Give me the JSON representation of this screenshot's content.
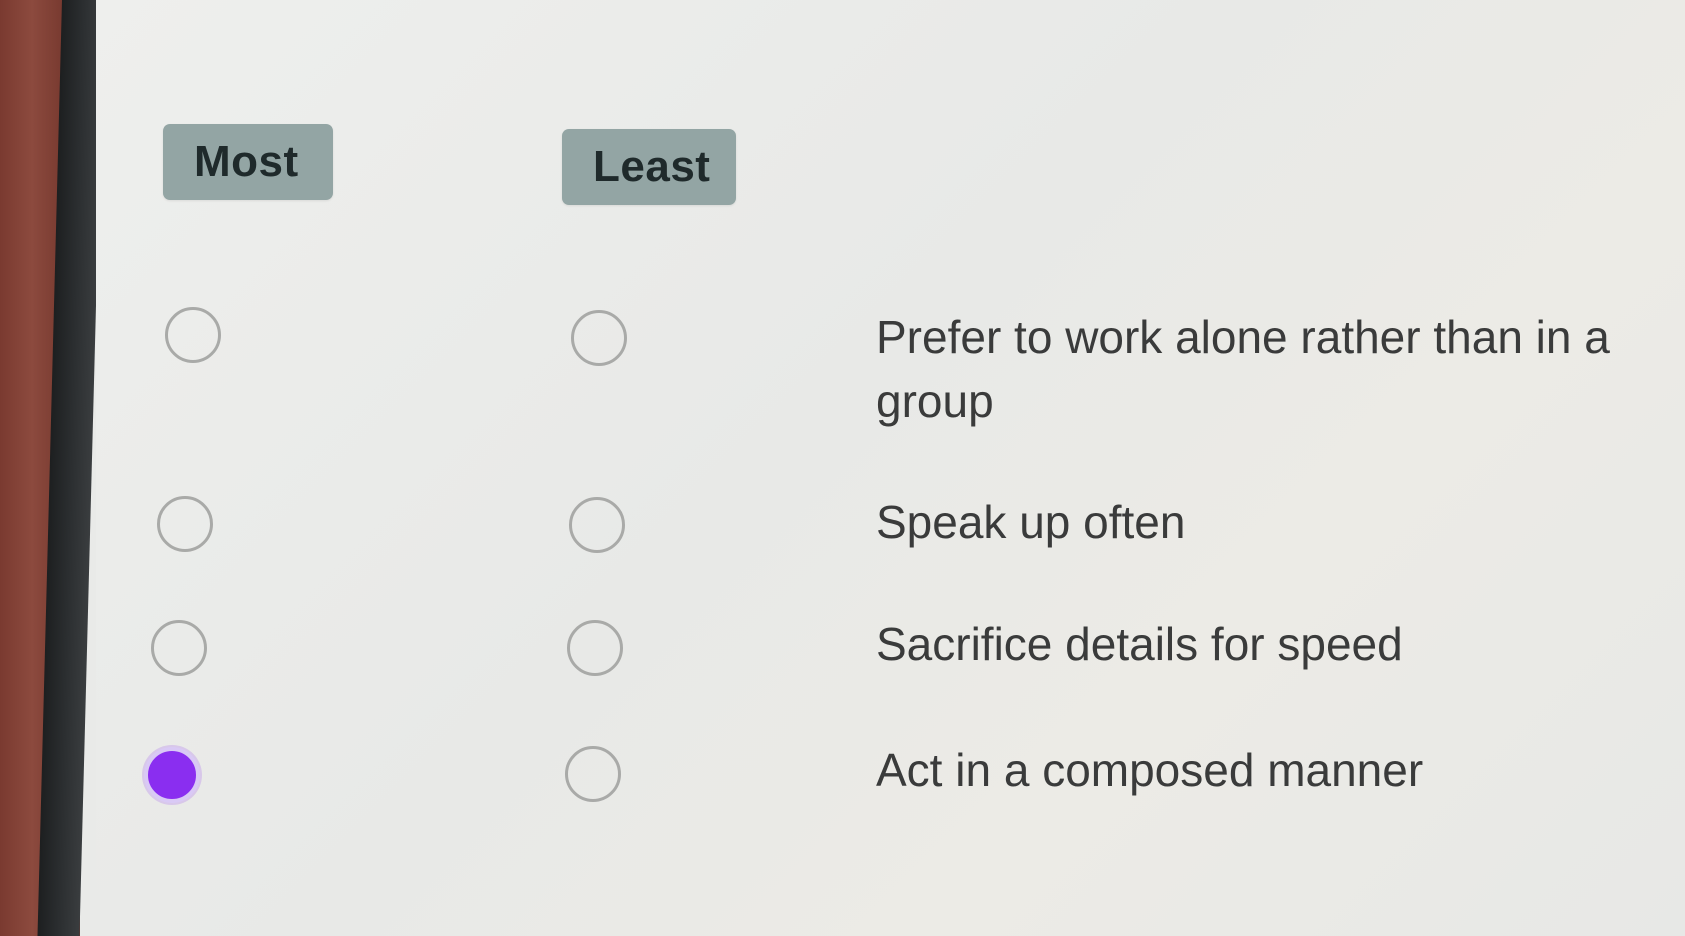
{
  "columns": {
    "most_label": "Most",
    "least_label": "Least"
  },
  "rows": [
    {
      "statement": "Prefer to work alone rather than in a group",
      "most_selected": false,
      "least_selected": false
    },
    {
      "statement": "Speak up often",
      "most_selected": false,
      "least_selected": false
    },
    {
      "statement": "Sacrifice details for speed",
      "most_selected": false,
      "least_selected": false
    },
    {
      "statement": "Act in a composed manner",
      "most_selected": true,
      "least_selected": false
    }
  ],
  "colors": {
    "accent": "#8a2ef0",
    "badge": "#93a5a4",
    "radio_border": "#a9aaa8",
    "text": "#3a3b3b"
  }
}
